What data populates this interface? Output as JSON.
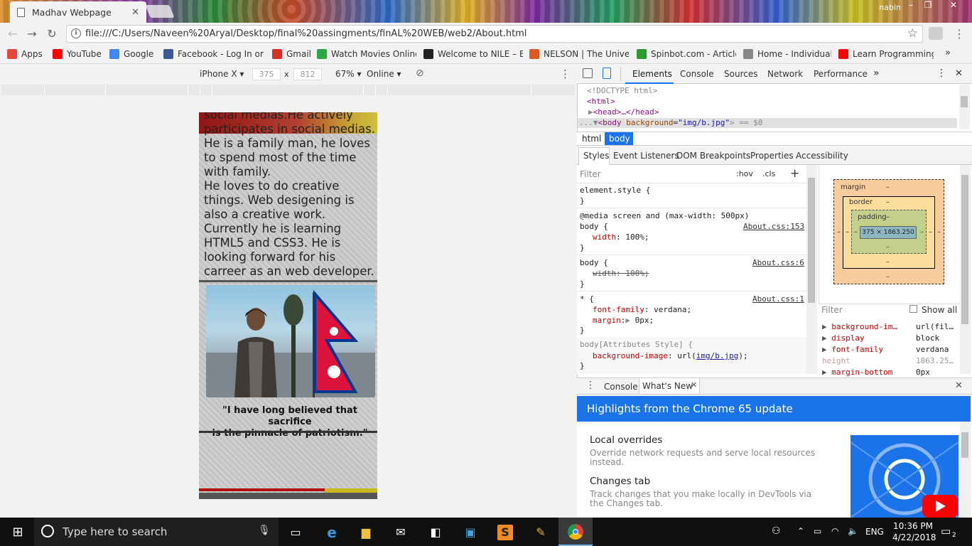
{
  "window": {
    "tab_title": "Madhav Webpage",
    "user": "nabin",
    "minimize": "–",
    "restore": "❐",
    "close": "✕"
  },
  "address_bar": {
    "url": "file:///C:/Users/Naveen%20Aryal/Desktop/final%20assingments/finAL%20WEB/web2/About.html",
    "back": "←",
    "forward": "→",
    "reload": "↻",
    "star": "☆",
    "menu": "⋮"
  },
  "bookmarks": [
    {
      "label": "Apps",
      "color": "#e8453c"
    },
    {
      "label": "YouTube",
      "color": "#ff0000"
    },
    {
      "label": "Google",
      "color": "#4285f4"
    },
    {
      "label": "Facebook - Log In or",
      "color": "#3b5998"
    },
    {
      "label": "Gmail",
      "color": "#d93025"
    },
    {
      "label": "Watch Movies Online",
      "color": "#2aa844"
    },
    {
      "label": "Welcome to NILE – B",
      "color": "#222222"
    },
    {
      "label": "NELSON | The Unive",
      "color": "#e05a20"
    },
    {
      "label": "Spinbot.com - Article",
      "color": "#2a9a2a"
    },
    {
      "label": "Home - Individual",
      "color": "#888888"
    },
    {
      "label": "Learn Programming",
      "color": "#ff0000"
    }
  ],
  "device_toolbar": {
    "device": "iPhone X",
    "width": "375",
    "times": "x",
    "height": "812",
    "zoom": "67%",
    "network": "Online"
  },
  "page": {
    "bio_lines": [
      "social medias.He actively",
      "participates in social medias.",
      "He is a family man, he loves",
      "to spend most of the time",
      "with family.",
      "He loves to do creative",
      "things. Web desigening is",
      "also a creative work.",
      "Currently he is learning",
      "HTML5 and CSS3. He is",
      "looking forward for his",
      "carreer as an web developer."
    ],
    "quote_line1": "\"I have long believed that sacrifice",
    "quote_line2": "is the pinnacle of patriotism.\""
  },
  "devtools": {
    "tabs": [
      "Elements",
      "Console",
      "Sources",
      "Network",
      "Performance"
    ],
    "more": "»",
    "dom": {
      "doctype": "<!DOCTYPE html>",
      "html_open": "<html>",
      "head": "<head>…</head>",
      "body_tag": "<body",
      "body_attr": "background",
      "body_val": "\"img/b.jpg\"",
      "body_suffix": "> == $0",
      "dots": "..."
    },
    "crumbs": [
      "html",
      "body"
    ],
    "subtabs": [
      "Styles",
      "Event Listeners",
      "DOM Breakpoints",
      "Properties",
      "Accessibility"
    ],
    "filter_placeholder": "Filter",
    "hov": ":hov",
    "cls": ".cls",
    "plus": "+",
    "styles": {
      "element_style": "element.style {",
      "close": "}",
      "media": "@media screen and (max-width: 500px)",
      "body_open": "body {",
      "link1": "About.css:153",
      "width_prop": "width",
      "width_val": "100%;",
      "link2": "About.css:6",
      "width_struck": "width: 100%;",
      "star_open": "* {",
      "link3": "About.css:1",
      "ff_prop": "font-family",
      "ff_val": "verdana;",
      "margin_prop": "margin",
      "margin_val": "0px;",
      "attr_style": "body[Attributes Style] {",
      "bg_prop": "background-image",
      "bg_val_pre": "url(",
      "bg_val_link": "img/b.jpg",
      "bg_val_post": ");"
    },
    "box_model": {
      "margin": "margin",
      "border": "border",
      "padding": "padding",
      "dash": "–",
      "content": "375 × 1863.250"
    },
    "computed": {
      "filter": "Filter",
      "show_all": "Show all",
      "rows": [
        {
          "prop": "background-im…",
          "val": "url(fil…"
        },
        {
          "prop": "display",
          "val": "block"
        },
        {
          "prop": "font-family",
          "val": "verdana"
        },
        {
          "prop": "height",
          "val": "1863.25…"
        },
        {
          "prop": "margin-bottom",
          "val": "0px"
        }
      ]
    },
    "drawer": {
      "tabs": [
        "Console",
        "What's New"
      ],
      "highlights": "Highlights from the Chrome 65 update",
      "items": [
        {
          "title": "Local overrides",
          "desc": "Override network requests and serve local resources instead."
        },
        {
          "title": "Changes tab",
          "desc": "Track changes that you make locally in DevTools via the Changes tab."
        }
      ]
    }
  },
  "taskbar": {
    "search_placeholder": "Type here to search",
    "lang": "ENG",
    "time": "10:36 PM",
    "date": "4/22/2018",
    "notif_count": "2"
  }
}
